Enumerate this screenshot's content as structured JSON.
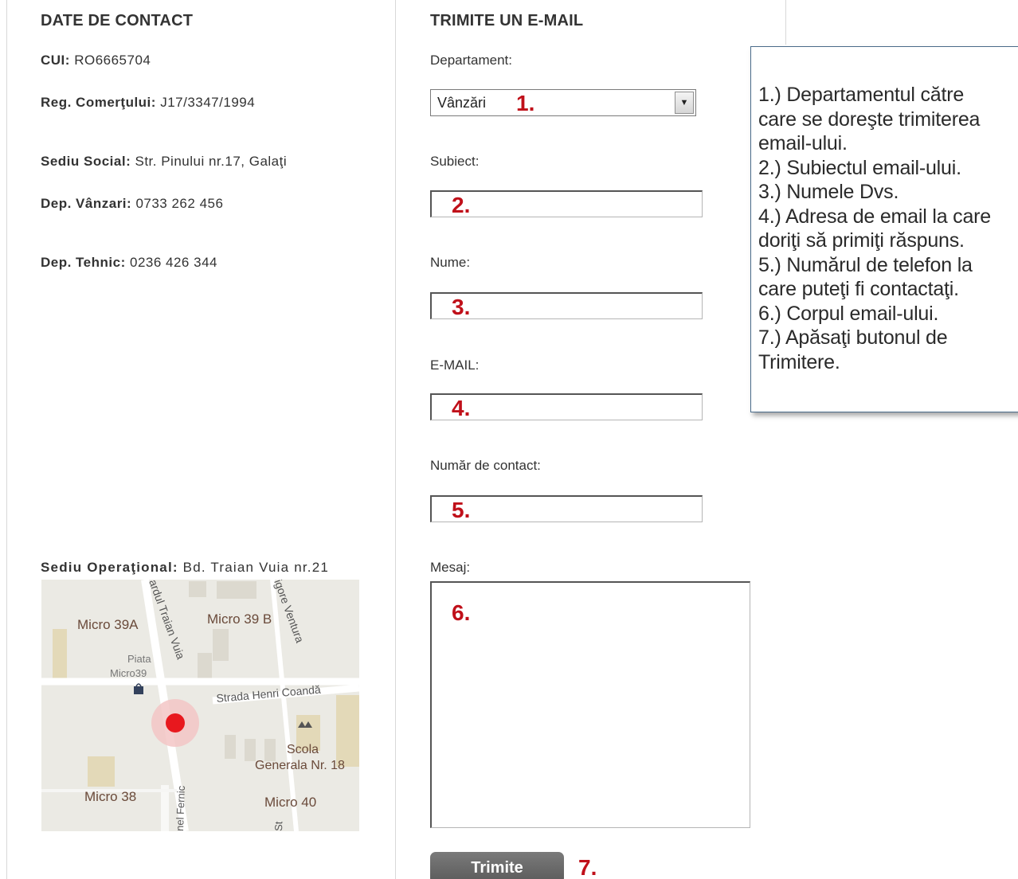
{
  "contact": {
    "title": "DATE DE CONTACT",
    "cui_label": "CUI:",
    "cui_value": "RO6665704",
    "reg_label": "Reg. Comerţului:",
    "reg_value": "J17/3347/1994",
    "sediu_label": "Sediu Social:",
    "sediu_value": "Str. Pinului nr.17, Galaţi",
    "vanzari_label": "Dep. Vânzari:",
    "vanzari_value": "0733 262 456",
    "tehnic_label": "Dep. Tehnic:",
    "tehnic_value": "0236 426 344",
    "operational_label": "Sediu Operaţional:",
    "operational_value": "Bd. Traian Vuia nr.21"
  },
  "map": {
    "labels": {
      "micro39a": "Micro 39A",
      "micro39b": "Micro 39 B",
      "piata1": "Piata",
      "piata2": "Micro39",
      "strada_henri": "Strada Henri Coandă",
      "scola1": "Scola",
      "scola2": "Generala Nr. 18",
      "micro38": "Micro 38",
      "micro40": "Micro 40",
      "traian": "ardul Traian Vuia",
      "ventura": "igore Ventura",
      "fernic": "nel Fernic",
      "st": "St"
    }
  },
  "form": {
    "title": "TRIMITE UN E-MAIL",
    "departament_label": "Departament:",
    "departament_value": "Vânzări",
    "subiect_label": "Subiect:",
    "nume_label": "Nume:",
    "email_label": "E-MAIL:",
    "numar_label": "Număr de contact:",
    "mesaj_label": "Mesaj:",
    "submit_label": "Trimite"
  },
  "markers": {
    "m1": "1.",
    "m2": "2.",
    "m3": "3.",
    "m4": "4.",
    "m5": "5.",
    "m6": "6.",
    "m7": "7."
  },
  "callout": {
    "lines": [
      "1.) Departamentul către",
      "care se doreşte trimiterea",
      "email-ului.",
      "2.) Subiectul email-ului.",
      "3.) Numele Dvs.",
      "4.) Adresa de email la care",
      "doriţi să primiţi răspuns.",
      "5.) Numărul de telefon la",
      "care puteţi fi contactaţi.",
      "6.) Corpul email-ului.",
      "7.) Apăsaţi butonul de",
      "Trimitere."
    ]
  },
  "colors": {
    "accent_red": "#c0101a",
    "button_gray": "#666666"
  }
}
